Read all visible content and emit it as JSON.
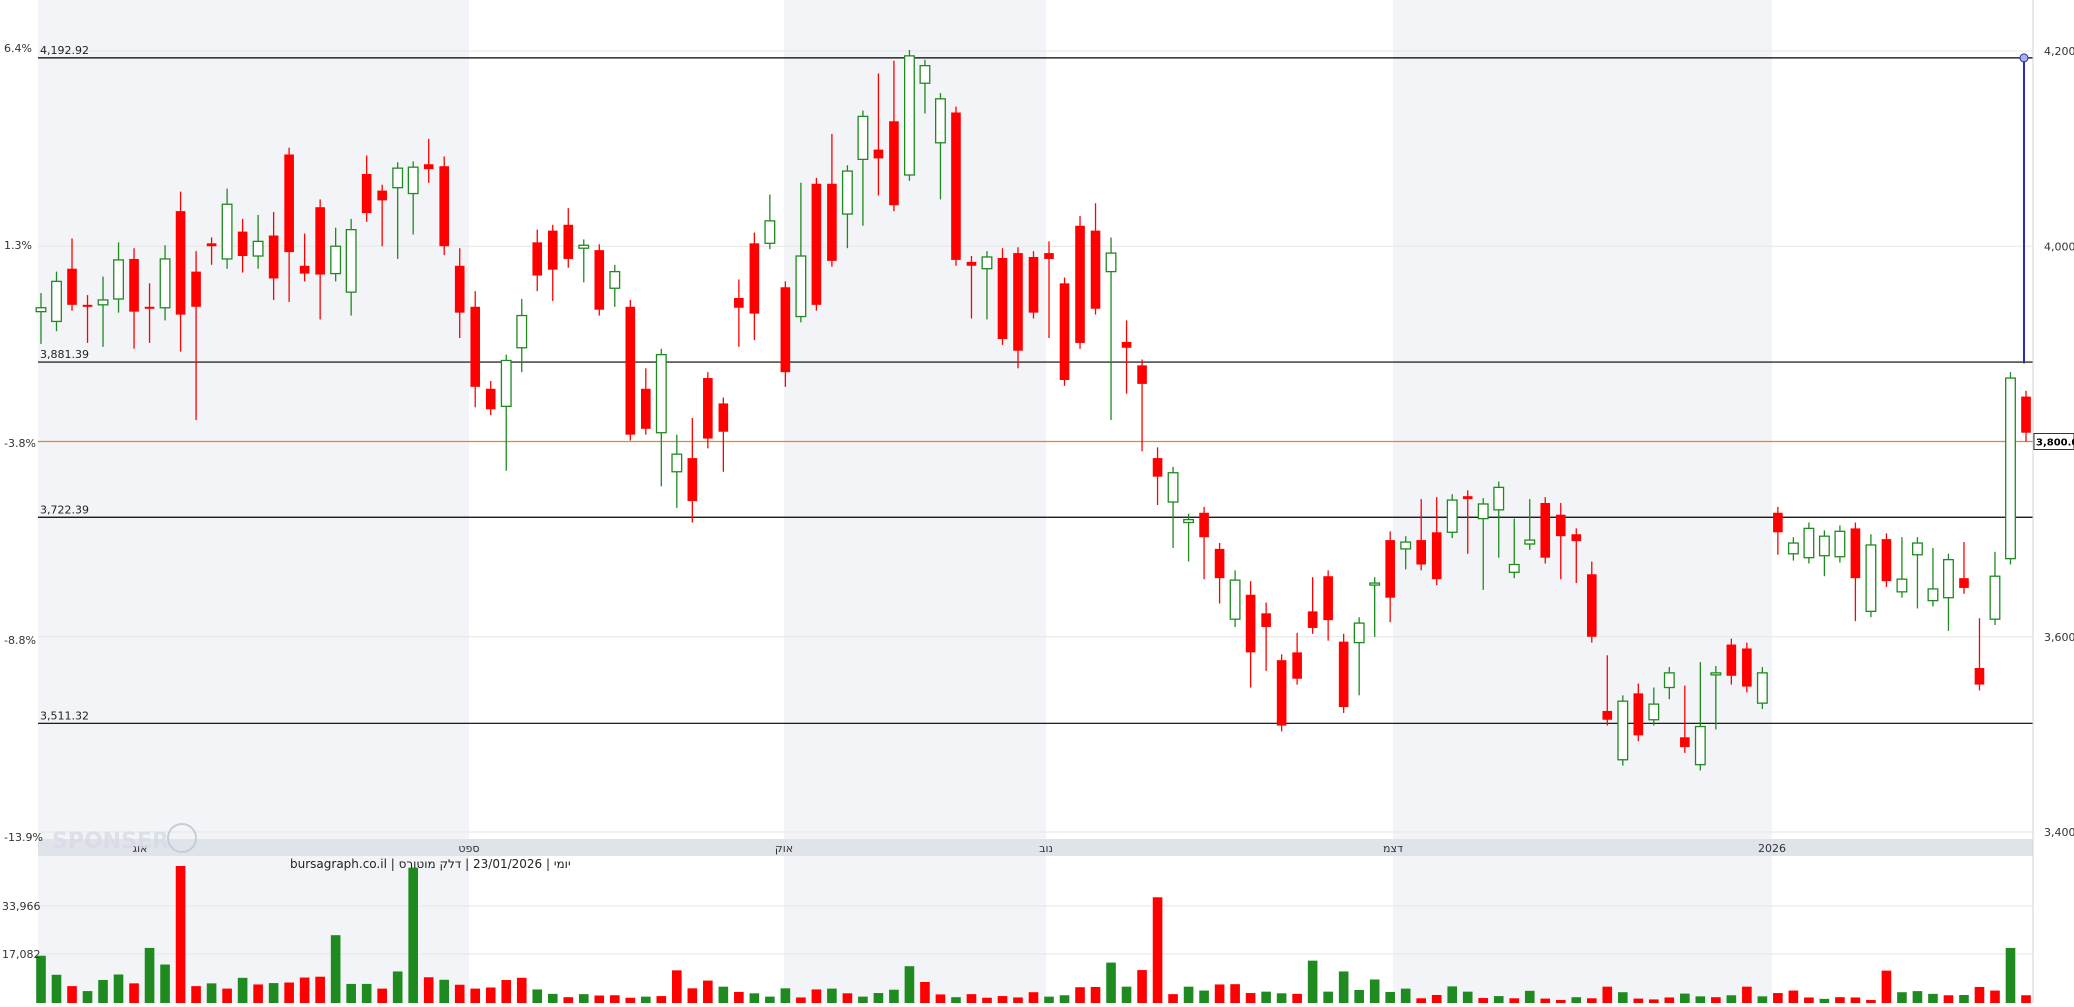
{
  "caption": "יומי | 23/01/2026 | דלק מוטורס | bursagraph.co.il",
  "watermark": "SPONSER",
  "price_marker": "3,800.00",
  "colors": {
    "up": "#1f8a1f",
    "down": "#ff0000",
    "band": "#f3f4f7",
    "grid": "#e6e6e6",
    "ref_line": "#000000",
    "current_line": "#e8832a",
    "measure_line": "#2a2aaa",
    "axis_text": "#333333",
    "month_strip": "#dfe3ea"
  },
  "chart_data": {
    "type": "candlestick",
    "price_axis": {
      "range": [
        3400,
        4200
      ],
      "ticks": [
        "4,200",
        "4,000",
        "3,600",
        "3,400"
      ]
    },
    "percent_axis": {
      "ticks": [
        "6.4%",
        "1.3%",
        "-3.8%",
        "-8.8%",
        "-13.9%"
      ]
    },
    "month_labels": [
      "אוג",
      "ספט",
      "אוק",
      "נוב",
      "דצמ",
      "2026"
    ],
    "reference_lines": [
      {
        "label": "4,192.92",
        "value": 4192.92
      },
      {
        "label": "3,881.39",
        "value": 3881.39
      },
      {
        "label": "3,722.39",
        "value": 3722.39
      },
      {
        "label": "3,511.32",
        "value": 3511.32
      }
    ],
    "current_price": 3800.0,
    "measure": {
      "from": 3880,
      "to": 4192.92
    },
    "candles": [
      [
        3933,
        3937,
        3906,
        3946
      ],
      [
        3923,
        3964,
        3919,
        3968
      ],
      [
        3977,
        3940,
        3940,
        4002
      ],
      [
        3940,
        3938,
        3907,
        3944
      ],
      [
        3940,
        3945,
        3903,
        3963
      ],
      [
        3946,
        3986,
        3938,
        3998
      ],
      [
        3987,
        3933,
        3901,
        3992
      ],
      [
        3938,
        3937,
        3907,
        3956
      ],
      [
        3937,
        3987,
        3930,
        3995
      ],
      [
        4036,
        3930,
        3898,
        4050
      ],
      [
        3974,
        3938,
        3828,
        3989
      ],
      [
        4003,
        4000,
        3987,
        4003
      ],
      [
        3987,
        4043,
        3983,
        4053
      ],
      [
        4015,
        3990,
        3979,
        4022
      ],
      [
        3990,
        4005,
        3983,
        4026
      ],
      [
        4011,
        3967,
        3951,
        4029
      ],
      [
        4094,
        3994,
        3949,
        4095
      ],
      [
        3980,
        3972,
        3970,
        4007
      ],
      [
        4040,
        3971,
        3931,
        4042
      ],
      [
        3972,
        4000,
        3970,
        4013
      ],
      [
        3953,
        4017,
        3935,
        4022
      ],
      [
        4074,
        4034,
        4031,
        4087
      ],
      [
        4057,
        4047,
        4006,
        4057
      ],
      [
        4060,
        4080,
        3993,
        4067
      ],
      [
        4054,
        4081,
        4018,
        4067
      ],
      [
        4084,
        4079,
        4071,
        4104
      ],
      [
        4082,
        4000,
        3997,
        4086
      ],
      [
        3980,
        3932,
        3912,
        3992
      ],
      [
        3938,
        3856,
        3841,
        3948
      ],
      [
        3854,
        3833,
        3850,
        3856
      ],
      [
        3836,
        3883,
        3776,
        3871
      ],
      [
        3896,
        3929,
        3877,
        3940
      ],
      [
        4004,
        3970,
        3960,
        4011
      ],
      [
        4016,
        3976,
        3950,
        4002
      ],
      [
        4022,
        3987,
        3984,
        4033
      ],
      [
        3998,
        4001,
        3969,
        4001
      ],
      [
        3996,
        3935,
        3937,
        3980
      ],
      [
        3957,
        3974,
        3944,
        3975
      ],
      [
        3938,
        3807,
        3844,
        3939
      ],
      [
        3854,
        3813,
        3833,
        3869
      ],
      [
        3809,
        3889,
        3760,
        3831
      ],
      [
        3769,
        3787,
        3738,
        3801
      ],
      [
        3783,
        3739,
        3723,
        3818
      ],
      [
        3865,
        3803,
        3799,
        3865
      ],
      [
        3839,
        3810,
        3775,
        3839
      ],
      [
        3947,
        3937,
        3903,
        3960
      ],
      [
        4003,
        3931,
        3910,
        4008
      ],
      [
        4003,
        4026,
        4047,
        4028
      ],
      [
        3958,
        3871,
        3862,
        3927
      ],
      [
        3928,
        3990,
        4059,
        4002
      ],
      [
        4064,
        3940,
        4016,
        4051
      ],
      [
        4064,
        3985,
        4067,
        4109
      ],
      [
        4033,
        4077,
        4004,
        4067
      ],
      [
        4089,
        4133,
        4027,
        4094
      ],
      [
        4099,
        4090,
        4058,
        4171
      ],
      [
        4128,
        4042,
        4053,
        4184
      ],
      [
        4073,
        4195,
        4165,
        4187
      ],
      [
        4167,
        4185,
        4142,
        4158
      ],
      [
        4106,
        4151,
        4054,
        4086
      ],
      [
        4137,
        3986,
        4003,
        4094
      ],
      [
        3984,
        3980,
        3983,
        3932
      ],
      [
        3977,
        3989,
        3931,
        3976
      ],
      [
        3988,
        3905,
        3992,
        3963
      ],
      [
        3993,
        3893,
        3881,
        3902
      ],
      [
        3989,
        3932,
        3961,
        3939
      ],
      [
        3993,
        3987,
        3912,
        3999
      ],
      [
        3962,
        3863,
        3907,
        3894
      ],
      [
        4021,
        3901,
        3928,
        4025
      ],
      [
        4016,
        3936,
        3937,
        4038
      ],
      [
        3974,
        3993,
        3828,
        4003
      ],
      [
        3902,
        3896,
        3855,
        3918
      ],
      [
        3878,
        3859,
        3796,
        3858
      ],
      [
        3783,
        3764,
        3741,
        3788
      ],
      [
        3738,
        3768,
        3697,
        3705
      ],
      [
        3717,
        3720,
        3698,
        3683
      ],
      [
        3727,
        3702,
        3665,
        3679
      ],
      [
        3690,
        3660,
        3640,
        3648
      ],
      [
        3618,
        3658,
        3662,
        3616
      ],
      [
        3643,
        3584,
        3554,
        3651
      ],
      [
        3624,
        3610,
        3571,
        3629
      ],
      [
        3576,
        3509,
        3565,
        3553
      ],
      [
        3584,
        3557,
        3598,
        3580
      ],
      [
        3626,
        3609,
        3655,
        3633
      ],
      [
        3662,
        3617,
        3605,
        3602
      ],
      [
        3595,
        3528,
        3544,
        3597
      ],
      [
        3594,
        3614,
        3546,
        3607
      ],
      [
        3653,
        3655,
        3606,
        3652
      ],
      [
        3699,
        3640,
        3621,
        3702
      ],
      [
        3690,
        3697,
        3692,
        3675
      ],
      [
        3699,
        3674,
        3714,
        3735
      ],
      [
        3707,
        3659,
        3737,
        3731
      ],
      [
        3707,
        3740,
        3710,
        3739
      ],
      [
        3744,
        3741,
        3691,
        3730
      ],
      [
        3721,
        3736,
        3723,
        3654
      ],
      [
        3730,
        3753,
        3687,
        3701
      ],
      [
        3666,
        3674,
        3711,
        3715
      ],
      [
        3695,
        3699,
        3732,
        3735
      ],
      [
        3737,
        3681,
        3702,
        3722
      ],
      [
        3725,
        3703,
        3731,
        3665
      ],
      [
        3705,
        3698,
        3661,
        3670
      ],
      [
        3664,
        3600,
        3614,
        3671
      ],
      [
        3524,
        3515,
        3575,
        3543
      ],
      [
        3474,
        3534,
        3478,
        3483
      ],
      [
        3542,
        3499,
        3508,
        3546
      ],
      [
        3515,
        3531,
        3521,
        3542
      ],
      [
        3548,
        3563,
        3542,
        3551
      ],
      [
        3497,
        3487,
        3544,
        3540
      ],
      [
        3469,
        3508,
        3534,
        3568
      ],
      [
        3563,
        3563,
        3564,
        3511
      ],
      [
        3592,
        3560,
        3560,
        3557
      ],
      [
        3588,
        3549,
        3565,
        3575
      ],
      [
        3532,
        3563,
        3533,
        3539
      ],
      [
        3727,
        3707,
        3690,
        3699
      ],
      [
        3685,
        3696,
        3684,
        3686
      ],
      [
        3681,
        3711,
        3690,
        3688
      ],
      [
        3683,
        3703,
        3668,
        3678
      ],
      [
        3682,
        3708,
        3687,
        3690
      ],
      [
        3711,
        3660,
        3622,
        3710
      ],
      [
        3626,
        3694,
        3680,
        3699
      ],
      [
        3700,
        3657,
        3659,
        3698
      ],
      [
        3646,
        3659,
        3690,
        3696
      ],
      [
        3684,
        3696,
        3683,
        3635
      ],
      [
        3637,
        3649,
        3685,
        3683
      ],
      [
        3640,
        3679,
        3612,
        3613
      ],
      [
        3660,
        3650,
        3678,
        3691
      ],
      [
        3568,
        3551,
        3578,
        3613
      ],
      [
        3618,
        3662,
        3681,
        3666
      ],
      [
        3680,
        3865,
        3802,
        3816
      ],
      [
        3846,
        3809,
        3806,
        3825
      ]
    ],
    "volume_axis": {
      "ticks": [
        "33,966",
        "17,082"
      ]
    },
    "volumes": [
      [
        17082,
        1
      ],
      [
        10200,
        1
      ],
      [
        6100,
        0
      ],
      [
        4300,
        1
      ],
      [
        8300,
        1
      ],
      [
        10300,
        1
      ],
      [
        7100,
        0
      ],
      [
        19900,
        1
      ],
      [
        13900,
        1
      ],
      [
        49500,
        0
      ],
      [
        6100,
        0
      ],
      [
        7100,
        1
      ],
      [
        5200,
        0
      ],
      [
        9100,
        1
      ],
      [
        6700,
        0
      ],
      [
        7200,
        1
      ],
      [
        7400,
        0
      ],
      [
        9200,
        0
      ],
      [
        9500,
        0
      ],
      [
        24500,
        1
      ],
      [
        6900,
        1
      ],
      [
        6900,
        1
      ],
      [
        5200,
        0
      ],
      [
        11400,
        1
      ],
      [
        48900,
        1
      ],
      [
        9300,
        0
      ],
      [
        8400,
        1
      ],
      [
        6600,
        0
      ],
      [
        5200,
        0
      ],
      [
        5600,
        0
      ],
      [
        8300,
        0
      ],
      [
        9100,
        0
      ],
      [
        4900,
        1
      ],
      [
        3300,
        1
      ],
      [
        2100,
        0
      ],
      [
        3200,
        1
      ],
      [
        2700,
        0
      ],
      [
        2800,
        0
      ],
      [
        1900,
        0
      ],
      [
        2300,
        1
      ],
      [
        2500,
        0
      ],
      [
        11800,
        0
      ],
      [
        5300,
        0
      ],
      [
        8100,
        0
      ],
      [
        5900,
        1
      ],
      [
        4000,
        0
      ],
      [
        3500,
        1
      ],
      [
        2300,
        1
      ],
      [
        5300,
        1
      ],
      [
        2000,
        0
      ],
      [
        4900,
        0
      ],
      [
        5200,
        1
      ],
      [
        3500,
        0
      ],
      [
        2300,
        1
      ],
      [
        3600,
        1
      ],
      [
        4800,
        1
      ],
      [
        13300,
        1
      ],
      [
        7600,
        0
      ],
      [
        3100,
        0
      ],
      [
        2100,
        1
      ],
      [
        3200,
        0
      ],
      [
        1900,
        0
      ],
      [
        2500,
        0
      ],
      [
        2000,
        0
      ],
      [
        3900,
        0
      ],
      [
        2300,
        1
      ],
      [
        2800,
        1
      ],
      [
        5700,
        0
      ],
      [
        5800,
        0
      ],
      [
        14600,
        1
      ],
      [
        5900,
        1
      ],
      [
        11900,
        0
      ],
      [
        38200,
        0
      ],
      [
        3200,
        0
      ],
      [
        5900,
        1
      ],
      [
        4500,
        1
      ],
      [
        6700,
        0
      ],
      [
        6800,
        0
      ],
      [
        3600,
        0
      ],
      [
        4100,
        1
      ],
      [
        3500,
        1
      ],
      [
        3300,
        0
      ],
      [
        15300,
        1
      ],
      [
        4100,
        1
      ],
      [
        11400,
        1
      ],
      [
        4700,
        1
      ],
      [
        8500,
        1
      ],
      [
        4000,
        1
      ],
      [
        5200,
        1
      ],
      [
        1700,
        0
      ],
      [
        2900,
        0
      ],
      [
        6000,
        1
      ],
      [
        4100,
        1
      ],
      [
        1800,
        0
      ],
      [
        2500,
        1
      ],
      [
        1700,
        0
      ],
      [
        4400,
        1
      ],
      [
        1600,
        0
      ],
      [
        1100,
        0
      ],
      [
        2100,
        1
      ],
      [
        1700,
        0
      ],
      [
        5900,
        0
      ],
      [
        3900,
        1
      ],
      [
        1600,
        0
      ],
      [
        1300,
        0
      ],
      [
        2000,
        0
      ],
      [
        3400,
        1
      ],
      [
        2400,
        1
      ],
      [
        2100,
        0
      ],
      [
        2800,
        1
      ],
      [
        5900,
        0
      ],
      [
        2400,
        1
      ],
      [
        3600,
        0
      ],
      [
        4500,
        0
      ],
      [
        2000,
        0
      ],
      [
        1500,
        1
      ],
      [
        2100,
        0
      ],
      [
        2000,
        0
      ],
      [
        1100,
        0
      ],
      [
        11700,
        0
      ],
      [
        3900,
        1
      ],
      [
        4300,
        1
      ],
      [
        3300,
        1
      ],
      [
        2800,
        0
      ],
      [
        2900,
        1
      ],
      [
        5800,
        0
      ],
      [
        4500,
        0
      ],
      [
        19900,
        1
      ],
      [
        2800,
        0
      ]
    ]
  }
}
